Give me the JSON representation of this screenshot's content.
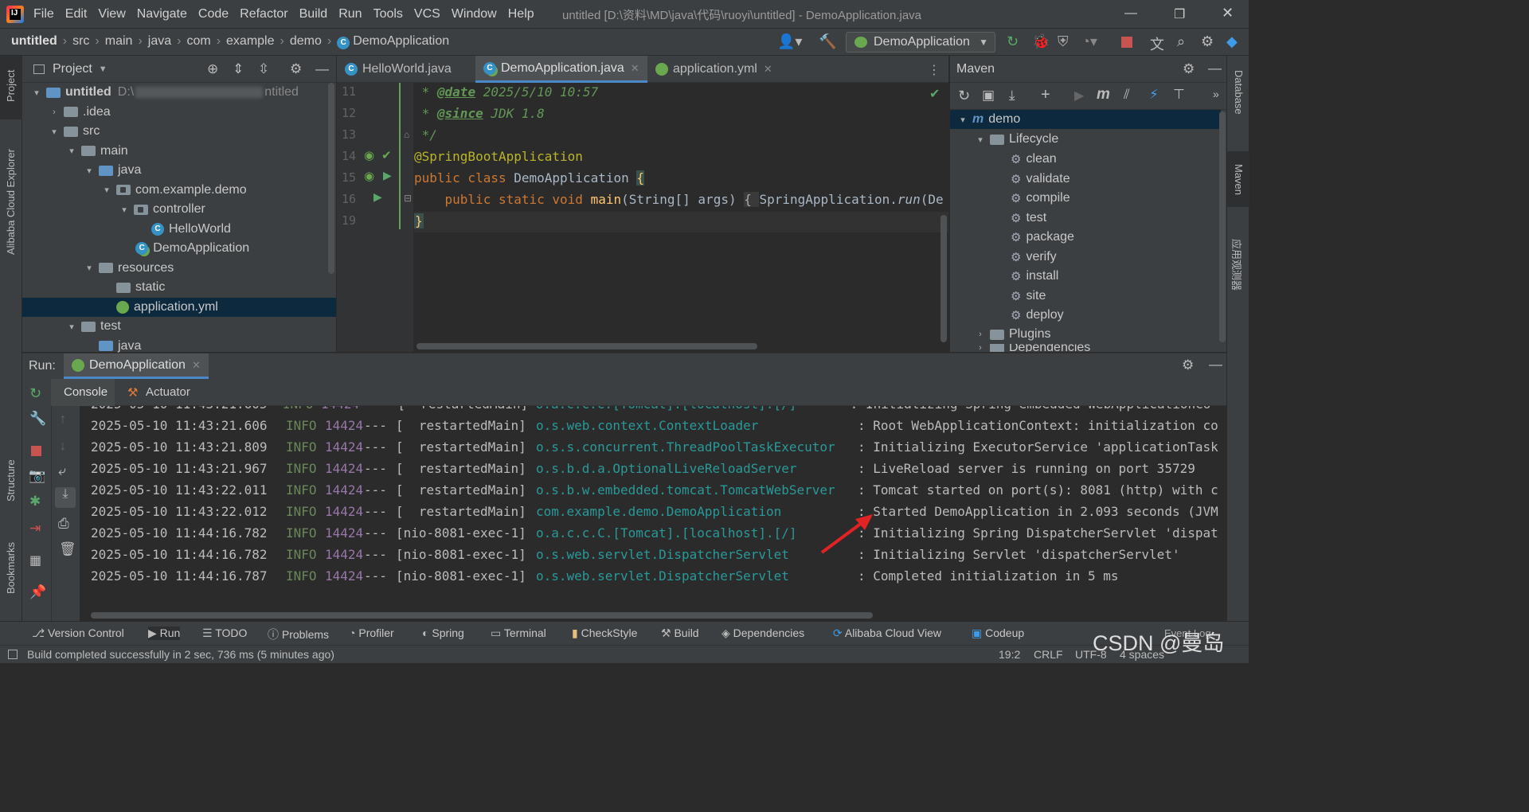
{
  "titlebar": {
    "menu": [
      "File",
      "Edit",
      "View",
      "Navigate",
      "Code",
      "Refactor",
      "Build",
      "Run",
      "Tools",
      "VCS",
      "Window",
      "Help"
    ],
    "title": "untitled [D:\\资料\\MD\\java\\代码\\ruoyi\\untitled] - DemoApplication.java"
  },
  "breadcrumb": [
    "untitled",
    "src",
    "main",
    "java",
    "com",
    "example",
    "demo",
    "DemoApplication"
  ],
  "run_config": "DemoApplication",
  "project": {
    "header": "Project",
    "tree": [
      {
        "label": "untitled",
        "extra": "D:\\",
        "extra2": "ntitled",
        "type": "module",
        "indent": 0,
        "arrow": "▾"
      },
      {
        "label": ".idea",
        "type": "folder",
        "indent": 1,
        "arrow": "›"
      },
      {
        "label": "src",
        "type": "folder",
        "indent": 1,
        "arrow": "▾"
      },
      {
        "label": "main",
        "type": "folder",
        "indent": 2,
        "arrow": "▾"
      },
      {
        "label": "java",
        "type": "srcfolder",
        "indent": 3,
        "arrow": "▾"
      },
      {
        "label": "com.example.demo",
        "type": "package",
        "indent": 4,
        "arrow": "▾"
      },
      {
        "label": "controller",
        "type": "package",
        "indent": 5,
        "arrow": "▾"
      },
      {
        "label": "HelloWorld",
        "type": "class",
        "indent": 6,
        "arrow": ""
      },
      {
        "label": "DemoApplication",
        "type": "springclass",
        "indent": 5.1,
        "arrow": ""
      },
      {
        "label": "resources",
        "type": "resfolder",
        "indent": 3,
        "arrow": "▾"
      },
      {
        "label": "static",
        "type": "folder",
        "indent": 4,
        "arrow": ""
      },
      {
        "label": "application.yml",
        "type": "yml",
        "indent": 4,
        "arrow": "",
        "selected": true
      },
      {
        "label": "test",
        "type": "folder",
        "indent": 2,
        "arrow": "▾"
      },
      {
        "label": "java",
        "type": "srcfolder",
        "indent": 3,
        "arrow": ""
      }
    ]
  },
  "editor": {
    "tabs": [
      {
        "label": "HelloWorld.java",
        "active": false,
        "close": false
      },
      {
        "label": "DemoApplication.java",
        "active": true,
        "close": true
      },
      {
        "label": "application.yml",
        "active": false,
        "close": true
      }
    ],
    "line_numbers": [
      "11",
      "12",
      "13",
      "14",
      "15",
      "16",
      "19"
    ],
    "lines": {
      "l11_tag": "@date",
      "l11_rest": " 2025/5/10 10:57",
      "l12_tag": "@since",
      "l12_rest": " JDK 1.8",
      "l13": " */",
      "l14": "@SpringBootApplication",
      "l15_kw": "public class ",
      "l15_name": "DemoApplication ",
      "l15_brace": "{",
      "l16_kw": "    public static void ",
      "l16_fn": "main",
      "l16_args": "(String[] args) ",
      "l16_fold": "{ ",
      "l16_call": "SpringApplication.",
      "l16_run": "run",
      "l16_tail": "(De",
      "l19": "}"
    }
  },
  "maven": {
    "header": "Maven",
    "root": "demo",
    "lifecycle": "Lifecycle",
    "goals": [
      "clean",
      "validate",
      "compile",
      "test",
      "package",
      "verify",
      "install",
      "site",
      "deploy"
    ],
    "plugins": "Plugins",
    "deps": "Dependencies"
  },
  "run": {
    "label": "Run:",
    "tab": "DemoApplication",
    "subtabs": [
      "Console",
      "Actuator"
    ],
    "logs": [
      {
        "ts": "2025-05-10 11:43:21.606",
        "lvl": "INFO",
        "pid": "14424",
        "sep": "---",
        "thread": "[  restartedMain]",
        "logger": "o.s.web.context.ContextLoader",
        "msg": ": Root WebApplicationContext: initialization co"
      },
      {
        "ts": "2025-05-10 11:43:21.809",
        "lvl": "INFO",
        "pid": "14424",
        "sep": "---",
        "thread": "[  restartedMain]",
        "logger": "o.s.s.concurrent.ThreadPoolTaskExecutor",
        "msg": ": Initializing ExecutorService 'applicationTask"
      },
      {
        "ts": "2025-05-10 11:43:21.967",
        "lvl": "INFO",
        "pid": "14424",
        "sep": "---",
        "thread": "[  restartedMain]",
        "logger": "o.s.b.d.a.OptionalLiveReloadServer",
        "msg": ": LiveReload server is running on port 35729"
      },
      {
        "ts": "2025-05-10 11:43:22.011",
        "lvl": "INFO",
        "pid": "14424",
        "sep": "---",
        "thread": "[  restartedMain]",
        "logger": "o.s.b.w.embedded.tomcat.TomcatWebServer",
        "msg": ": Tomcat started on port(s): 8081 (http) with c"
      },
      {
        "ts": "2025-05-10 11:43:22.012",
        "lvl": "INFO",
        "pid": "14424",
        "sep": "---",
        "thread": "[  restartedMain]",
        "logger": "com.example.demo.DemoApplication",
        "msg": ": Started DemoApplication in 2.093 seconds (JVM"
      },
      {
        "ts": "2025-05-10 11:44:16.782",
        "lvl": "INFO",
        "pid": "14424",
        "sep": "---",
        "thread": "[nio-8081-exec-1]",
        "logger": "o.a.c.c.C.[Tomcat].[localhost].[/]",
        "msg": ": Initializing Spring DispatcherServlet 'dispat"
      },
      {
        "ts": "2025-05-10 11:44:16.782",
        "lvl": "INFO",
        "pid": "14424",
        "sep": "---",
        "thread": "[nio-8081-exec-1]",
        "logger": "o.s.web.servlet.DispatcherServlet",
        "msg": ": Initializing Servlet 'dispatcherServlet'"
      },
      {
        "ts": "2025-05-10 11:44:16.787",
        "lvl": "INFO",
        "pid": "14424",
        "sep": "---",
        "thread": "[nio-8081-exec-1]",
        "logger": "o.s.web.servlet.DispatcherServlet",
        "msg": ": Completed initialization in 5 ms"
      }
    ]
  },
  "left_stripe": [
    "Project",
    "Alibaba Cloud Explorer",
    "Structure",
    "Bookmarks"
  ],
  "right_stripe": [
    "Database",
    "Maven",
    "应用观测器"
  ],
  "toolwindows": [
    "Version Control",
    "Run",
    "TODO",
    "Problems",
    "Profiler",
    "Spring",
    "Terminal",
    "CheckStyle",
    "Build",
    "Dependencies",
    "Alibaba Cloud View",
    "Codeup"
  ],
  "event_log": "Event Log",
  "status": {
    "message": "Build completed successfully in 2 sec, 736 ms (5 minutes ago)",
    "position": "19:2",
    "line_sep": "CRLF",
    "encoding": "UTF-8",
    "indent": "4 spaces"
  },
  "watermark": "CSDN @曼岛",
  "colors": {
    "accent": "#4a88c7",
    "selection": "#0d293e",
    "arrow": "#e02424"
  }
}
